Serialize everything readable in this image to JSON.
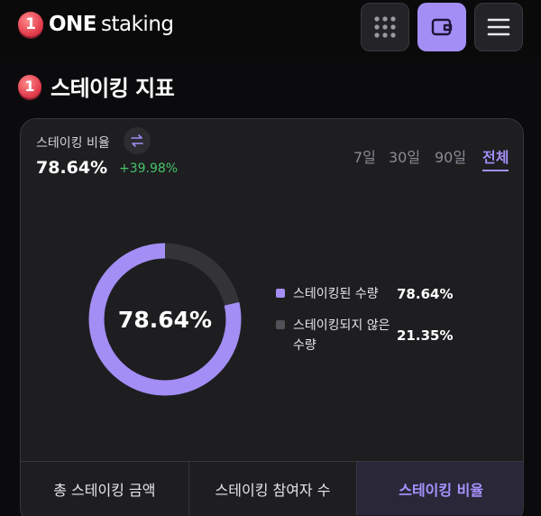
{
  "header": {
    "logo_badge": "1",
    "brand_strong": "ONE",
    "brand_light": "staking",
    "buttons": [
      {
        "name": "apps-grid",
        "icon": "grid-dots-icon"
      },
      {
        "name": "wallet",
        "icon": "wallet-icon"
      },
      {
        "name": "menu",
        "icon": "hamburger-menu-icon"
      }
    ]
  },
  "section": {
    "badge": "1",
    "title": "스테이킹 지표"
  },
  "card": {
    "metric_label": "스테이킹 비율",
    "metric_value": "78.64%",
    "metric_change": "+39.98%",
    "periods": [
      "7일",
      "30일",
      "90일",
      "전체"
    ],
    "active_period": "전체",
    "donut": {
      "center_text": "78.64%",
      "staked_fraction": 0.7864
    },
    "legend": [
      {
        "label": "스테이킹된 수량",
        "value": "78.64%",
        "color": "#a28ef5"
      },
      {
        "label": "스테이킹되지 않은 수량",
        "value": "21.35%",
        "color": "#505056"
      }
    ],
    "tabs": [
      "총 스테이킹 금액",
      "스테이킹 참여자 수",
      "스테이킹 비율"
    ],
    "active_tab": "스테이킹 비율"
  },
  "colors": {
    "accent": "#a28ef5",
    "positive": "#46c46a",
    "background": "#0b0b0d",
    "card": "#1e1e21"
  }
}
